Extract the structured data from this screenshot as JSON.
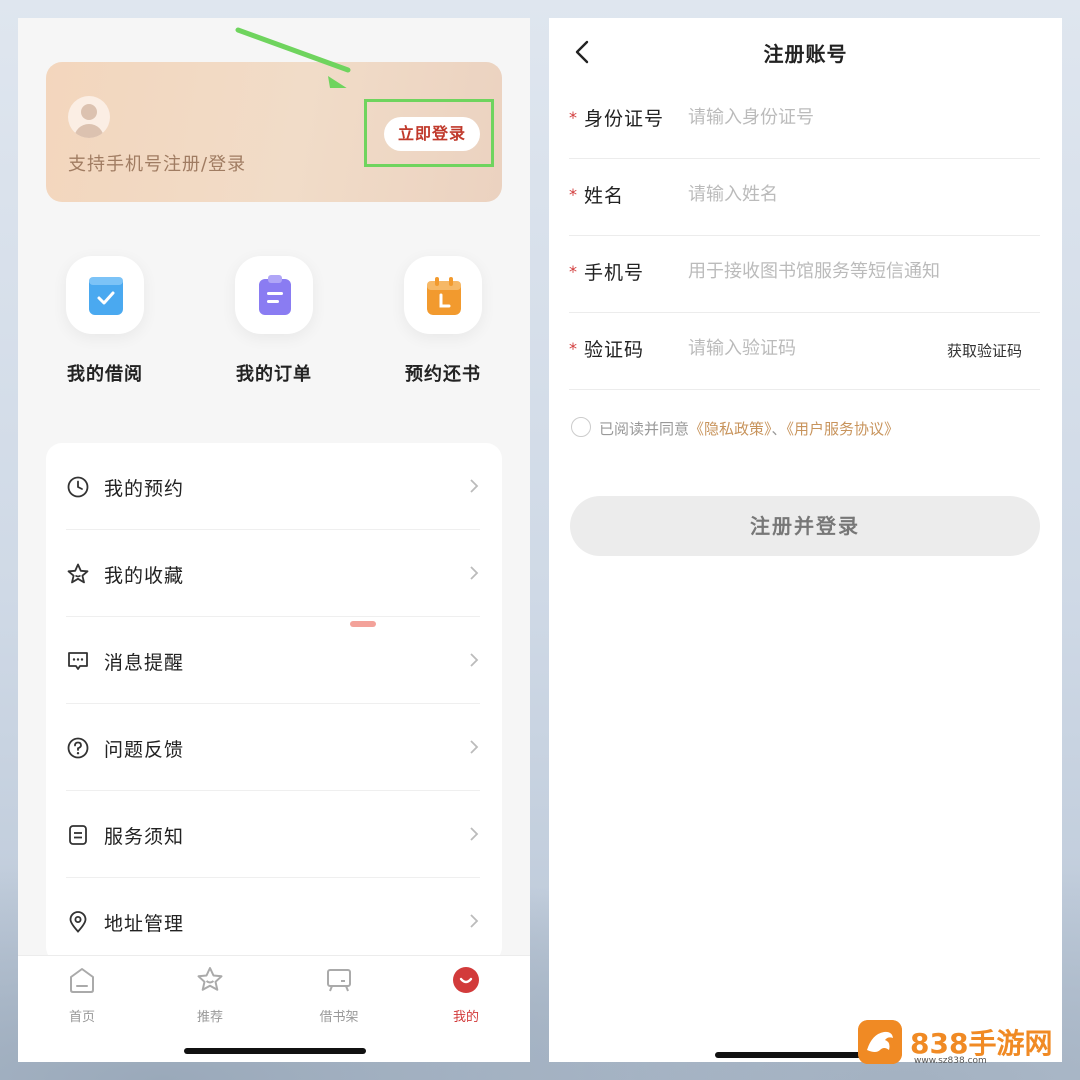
{
  "left": {
    "login_card": {
      "hint": "支持手机号注册/登录",
      "login_button": "立即登录"
    },
    "shortcuts": [
      {
        "label": "我的借阅",
        "icon": "borrow-icon",
        "color": "#4aa9f0"
      },
      {
        "label": "我的订单",
        "icon": "order-icon",
        "color": "#8a7cf2"
      },
      {
        "label": "预约还书",
        "icon": "calendar-icon",
        "color": "#f29a2e"
      }
    ],
    "menu": [
      {
        "label": "我的预约",
        "icon": "clock-icon"
      },
      {
        "label": "我的收藏",
        "icon": "star-icon"
      },
      {
        "label": "消息提醒",
        "icon": "message-icon"
      },
      {
        "label": "问题反馈",
        "icon": "question-icon"
      },
      {
        "label": "服务须知",
        "icon": "document-icon"
      },
      {
        "label": "地址管理",
        "icon": "location-icon"
      }
    ],
    "tabbar": [
      {
        "label": "首页",
        "icon": "home-icon"
      },
      {
        "label": "推荐",
        "icon": "recommend-icon"
      },
      {
        "label": "借书架",
        "icon": "bookshelf-icon"
      },
      {
        "label": "我的",
        "icon": "profile-icon",
        "active": true
      }
    ]
  },
  "right": {
    "title": "注册账号",
    "fields": [
      {
        "label": "身份证号",
        "placeholder": "请输入身份证号"
      },
      {
        "label": "姓名",
        "placeholder": "请输入姓名"
      },
      {
        "label": "手机号",
        "placeholder": "用于接收图书馆服务等短信通知"
      },
      {
        "label": "验证码",
        "placeholder": "请输入验证码",
        "action": "获取验证码"
      }
    ],
    "agreement": {
      "prefix": "已阅读并同意",
      "privacy": "《隐私政策》",
      "sep": "、",
      "service": "《用户服务协议》"
    },
    "submit": "注册并登录"
  },
  "watermark": {
    "text": "838手游网",
    "url": "www.sz838.com"
  },
  "colors": {
    "accent": "#d23b3b",
    "link": "#c8945c",
    "highlight": "#6fd45e"
  }
}
